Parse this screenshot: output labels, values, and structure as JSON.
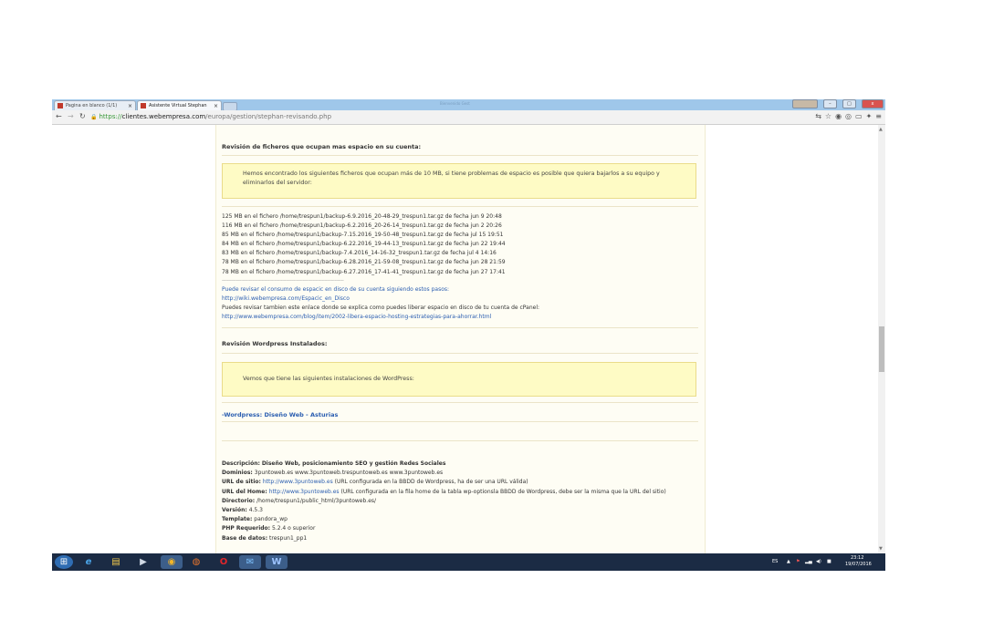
{
  "browser": {
    "tabs": [
      {
        "label": "Pagina en blanco (1/1)",
        "close": "×"
      },
      {
        "label": "Asistente Virtual Stephan",
        "close": "×"
      }
    ],
    "title_fade": "Bienvenido   Gest",
    "url": {
      "scheme": "https://",
      "domain": "clientes.webempresa.com",
      "path": "/europa/gestion/stephan-revisando.php"
    }
  },
  "files_section": {
    "title": "Revisión de ficheros que ocupan mas espacio en su cuenta:",
    "notice": "Hemos encontrado los siguientes ficheros que ocupan más de 10 MB, si tiene problemas de espacio es posible que quiera bajarlos a su equipo y eliminarlos del servidor:",
    "files": [
      "125 MB en el fichero /home/trespun1/backup-6.9.2016_20-48-29_trespun1.tar.gz de fecha jun 9 20:48",
      "116 MB en el fichero /home/trespun1/backup-6.2.2016_20-26-14_trespun1.tar.gz de fecha jun 2 20:26",
      "85 MB en el fichero /home/trespun1/backup-7.15.2016_19-50-48_trespun1.tar.gz de fecha jul 15 19:51",
      "84 MB en el fichero /home/trespun1/backup-6.22.2016_19-44-13_trespun1.tar.gz de fecha jun 22 19:44",
      "83 MB en el fichero /home/trespun1/backup-7.4.2016_14-16-32_trespun1.tar.gz de fecha jul 4 14:16",
      "78 MB en el fichero /home/trespun1/backup-6.28.2016_21-59-08_trespun1.tar.gz de fecha jun 28 21:59",
      "78 MB en el fichero /home/trespun1/backup-6.27.2016_17-41-41_trespun1.tar.gz de fecha jun 27 17:41"
    ],
    "divider": "-----------------------------------------------------------------------------------------------",
    "consumo_link": "Puede revisar el consumo de espacic en disco de su cuenta siguiendo estos pasos:",
    "wiki_link": "http://wiki.webempresa.com/Espacic_en_Disco",
    "liberar_text": "Puedes revisar tambien este enlace donde se explica como puedes liberar espacio en disco de tu cuenta de cPanel:",
    "blog_link": "http://www.webempresa.com/blog/item/2002-libera-espacio-hosting-estrategias-para-ahorrar.html"
  },
  "wp_section": {
    "title": "Revisión Wordpress Instalados:",
    "notice": "Vemos que tiene las siguientes instalaciones de WordPress:",
    "install_link": "-Wordpress: Diseño Web - Asturias"
  },
  "details": {
    "descripcion_label": "Descripción:",
    "descripcion_value": "Diseño Web, posicionamiento SEO y gestión Redes Sociales",
    "dominios_label": "Dominios:",
    "dominios_value": "3puntoweb.es www.3puntoweb.trespuntoweb.es www.3puntoweb.es",
    "url_sitio_label": "URL de sitio:",
    "url_sitio_link": "http://www.3puntoweb.es",
    "url_sitio_note": "(URL configurada en la BBDD de Wordpress, ha de ser una URL válida)",
    "url_home_label": "URL del Home:",
    "url_home_link": "http://www.3puntoweb.es",
    "url_home_note": "(URL configurada en la fila home de la tabla wp-optionsla BBDD de Wordpress, debe ser la misma que la URL del sitio)",
    "directorio_label": "Directorio:",
    "directorio_value": "/home/trespun1/public_html/3puntoweb.es/",
    "version_label": "Versión:",
    "version_value": "4.5.3",
    "template_label": "Template:",
    "template_value": "pandora_wp",
    "php_label": "PHP Requerido:",
    "php_value": "5.2.4 o superior",
    "bd_label": "Base de datos:",
    "bd_value": "trespun1_pp1"
  },
  "taskbar": {
    "lang": "ES",
    "time": "23:12",
    "date": "19/07/2016"
  },
  "colors": {
    "notice_bg": "#fefbc5",
    "link": "#2a5db0",
    "taskbar": "#1b2b44"
  }
}
